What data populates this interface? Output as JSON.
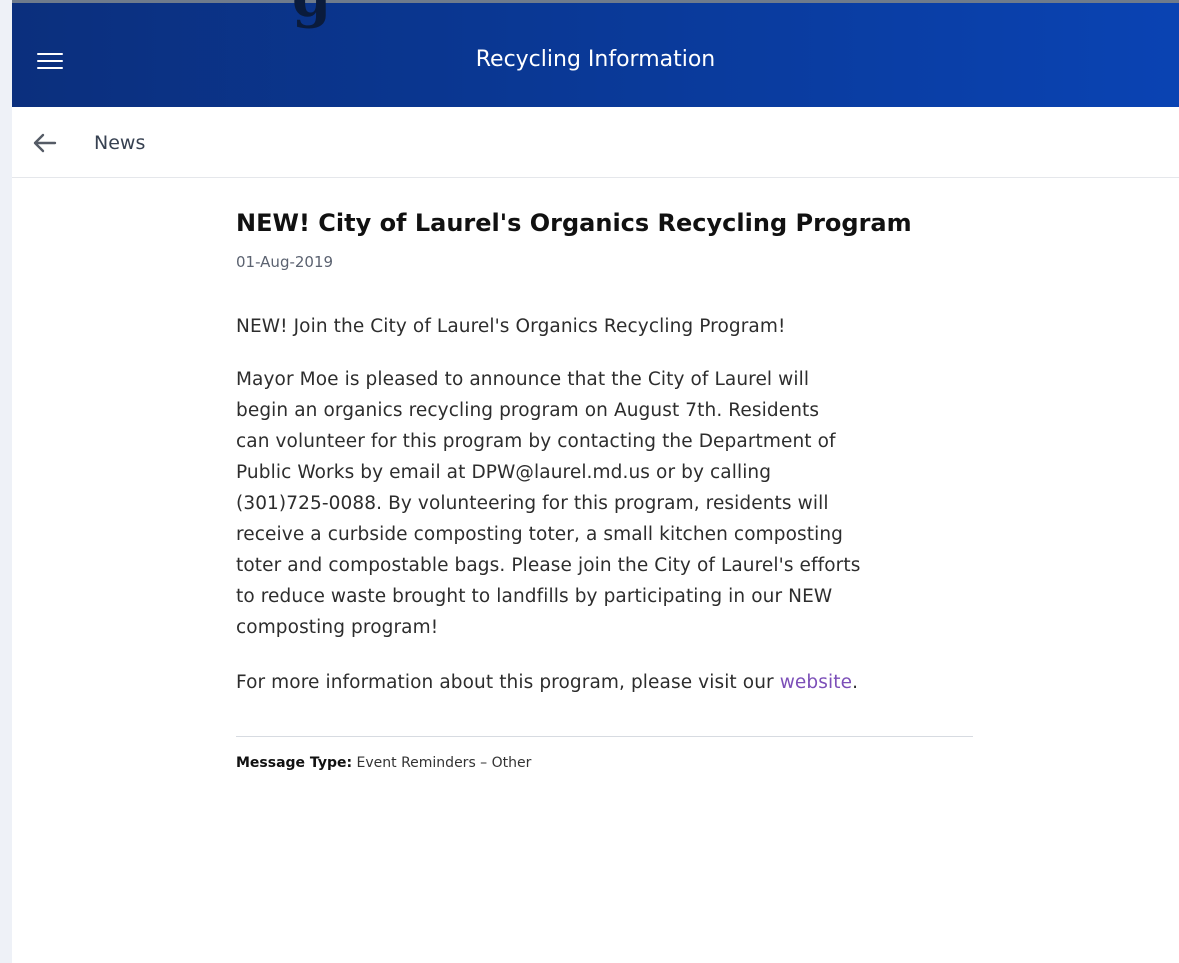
{
  "header": {
    "title": "Recycling Information",
    "title_fragment": "g",
    "gradient_colors": [
      "#0b2f7d",
      "#0a43b3"
    ],
    "menu_icon": "hamburger-menu-icon"
  },
  "navigation": {
    "back_icon": "arrow-left-icon",
    "back_label": "News"
  },
  "article": {
    "title": "NEW! City of Laurel's Organics Recycling Program",
    "date": "01-Aug-2019",
    "intro": "NEW! Join the City of Laurel's Organics Recycling Program!",
    "body_lines": [
      "Mayor Moe is pleased to announce that the City of Laurel will",
      "begin an organics recycling program on August 7th. Residents",
      "can volunteer for this program by contacting the Department of",
      "Public Works by email at DPW@laurel.md.us or by calling",
      "(301)725-0088. By volunteering for this program, residents will",
      "receive a curbside composting toter, a small kitchen composting",
      "toter and compostable bags. Please join the City of Laurel's efforts",
      "to reduce waste brought to landfills by participating in our NEW",
      "composting program!"
    ],
    "more_info_prefix": "For more information about this program, please visit our ",
    "more_info_link": "website",
    "more_info_suffix": ".",
    "link_color": "#7c4fb8",
    "message_type_label": "Message Type:",
    "message_type_value": "Event Reminders – Other"
  }
}
